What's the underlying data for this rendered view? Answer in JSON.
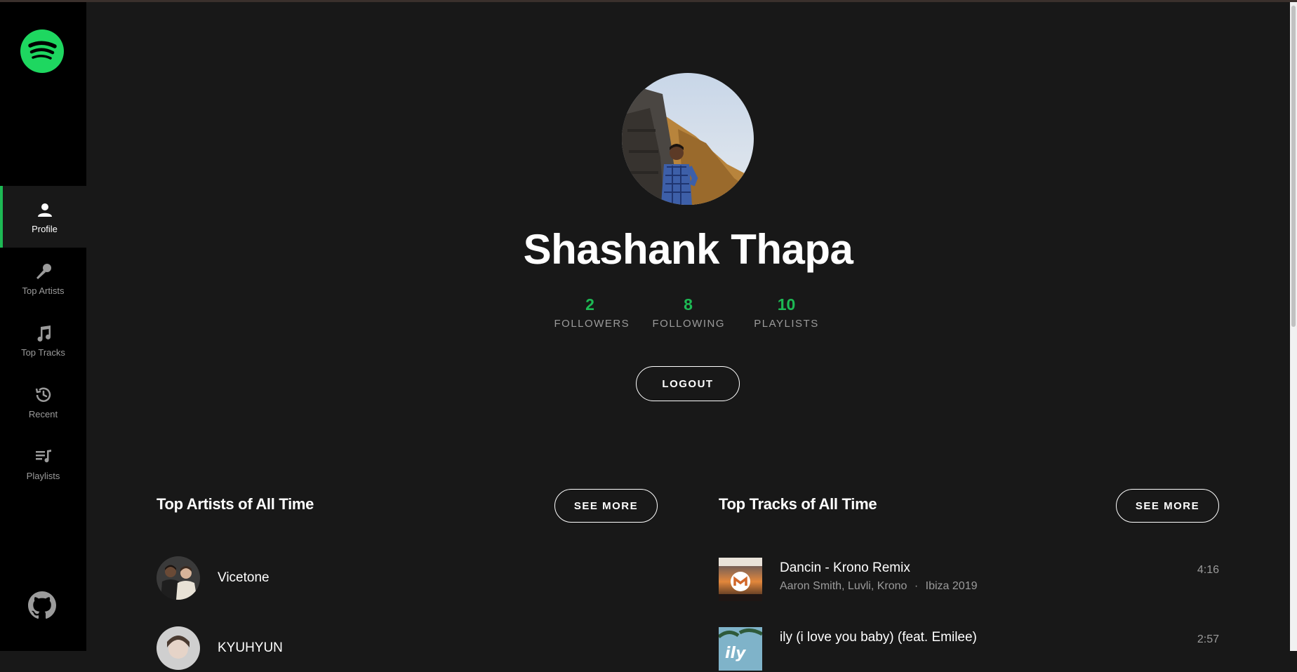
{
  "sidebar": {
    "logo": "spotify-logo",
    "items": [
      {
        "label": "Profile",
        "icon": "user-icon",
        "active": true
      },
      {
        "label": "Top Artists",
        "icon": "microphone-icon"
      },
      {
        "label": "Top Tracks",
        "icon": "music-note-icon"
      },
      {
        "label": "Recent",
        "icon": "history-icon"
      },
      {
        "label": "Playlists",
        "icon": "playlist-icon"
      }
    ],
    "footer_icon": "github-icon"
  },
  "profile": {
    "name": "Shashank Thapa",
    "stats": [
      {
        "value": "2",
        "label": "FOLLOWERS"
      },
      {
        "value": "8",
        "label": "FOLLOWING"
      },
      {
        "value": "10",
        "label": "PLAYLISTS"
      }
    ],
    "logout_label": "LOGOUT"
  },
  "top_artists": {
    "title": "Top Artists of All Time",
    "see_more_label": "SEE MORE",
    "items": [
      {
        "name": "Vicetone"
      },
      {
        "name": "KYUHYUN"
      }
    ]
  },
  "top_tracks": {
    "title": "Top Tracks of All Time",
    "see_more_label": "SEE MORE",
    "items": [
      {
        "title": "Dancin - Krono Remix",
        "artists": "Aaron Smith, Luvli, Krono",
        "separator": "·",
        "album": "Ibiza 2019",
        "duration": "4:16"
      },
      {
        "title": "ily (i love you baby) (feat. Emilee)",
        "artists": "",
        "separator": "",
        "album": "",
        "duration": "2:57",
        "album_art_text": "ily"
      }
    ]
  },
  "colors": {
    "accent": "#1db954",
    "background": "#181818",
    "sidebar": "#000000",
    "muted_text": "#9b9b9b"
  }
}
